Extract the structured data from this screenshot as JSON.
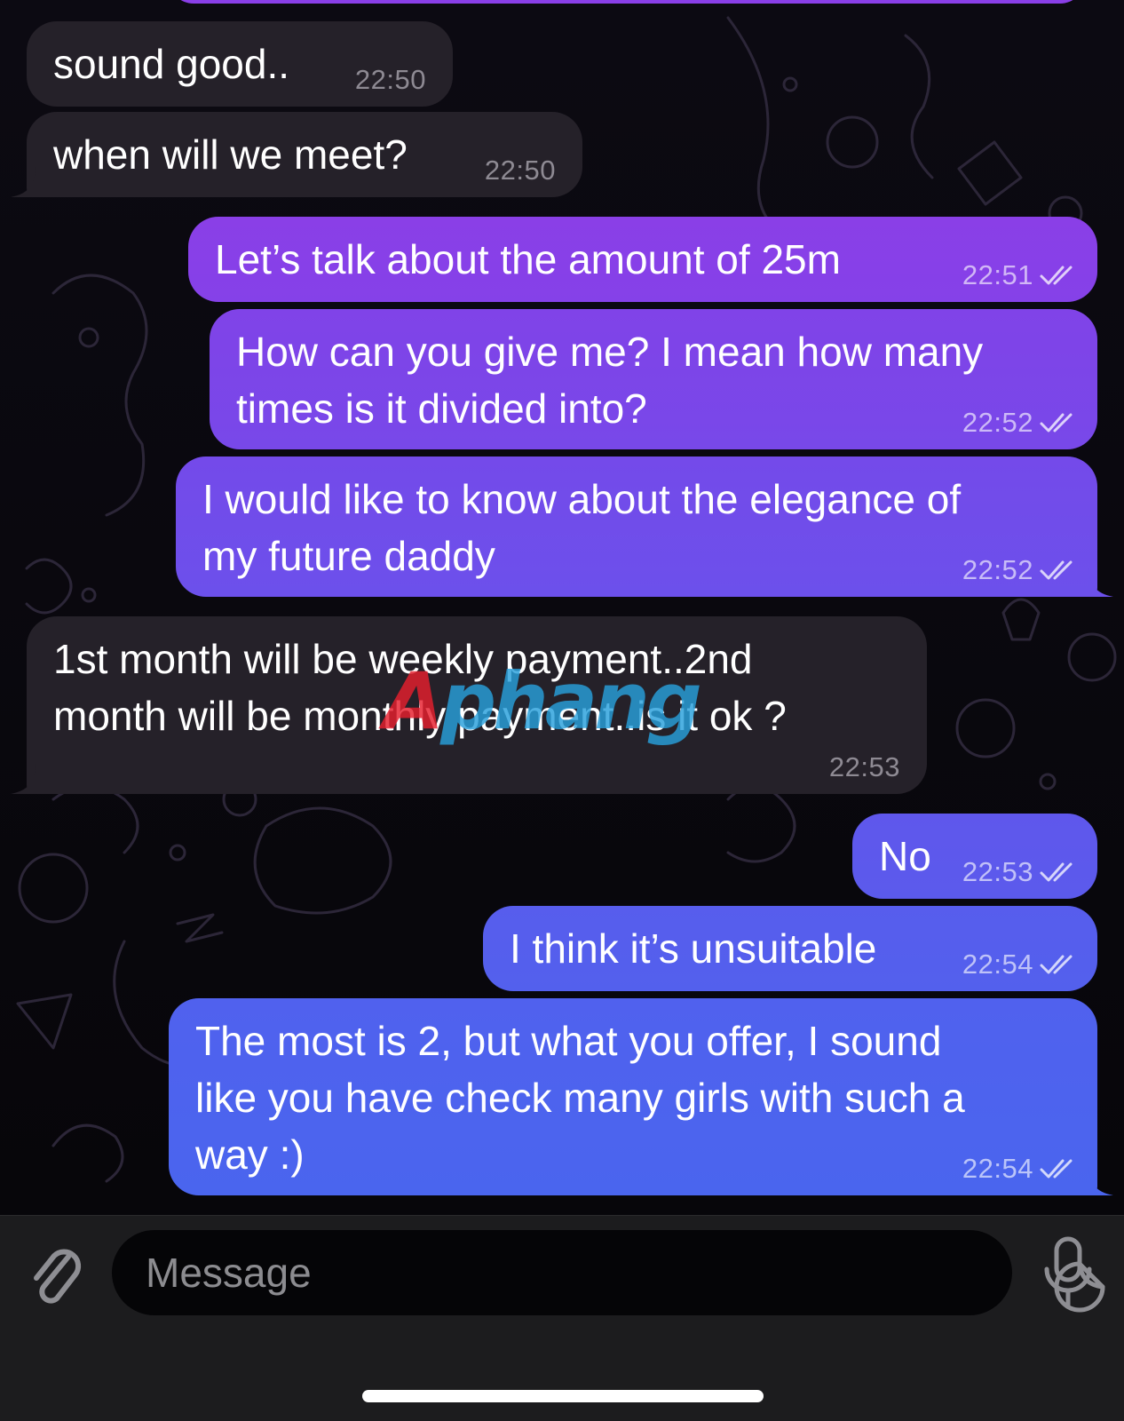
{
  "colors": {
    "incoming_bubble": "#252129",
    "outgoing_gradient_top": "#8a3fe7",
    "outgoing_gradient_bottom": "#4a65ee",
    "composer_bg": "#1c1c1e"
  },
  "messages": [
    {
      "direction": "incoming",
      "text": "sound good..",
      "time": "22:50",
      "read": false
    },
    {
      "direction": "incoming",
      "text": "when will we meet?",
      "time": "22:50",
      "read": false
    },
    {
      "direction": "outgoing",
      "text": "Let’s talk about the amount of 25m",
      "time": "22:51",
      "read": true
    },
    {
      "direction": "outgoing",
      "text": "How can you give me? I mean how many\ntimes is it divided into?",
      "time": "22:52",
      "read": true
    },
    {
      "direction": "outgoing",
      "text": "I would like to know about the elegance of\nmy future daddy",
      "time": "22:52",
      "read": true
    },
    {
      "direction": "incoming",
      "text": "1st month will be weekly payment..2nd\nmonth will be monthly payment..is it ok ?",
      "time": "22:53",
      "read": false
    },
    {
      "direction": "outgoing",
      "text": "No",
      "time": "22:53",
      "read": true
    },
    {
      "direction": "outgoing",
      "text": "I think it’s unsuitable",
      "time": "22:54",
      "read": true
    },
    {
      "direction": "outgoing",
      "text": "The most is 2, but what you offer, I sound\nlike you have check many girls with such a\nway :)",
      "time": "22:54",
      "read": true
    }
  ],
  "watermark": {
    "head": "A",
    "tail": "phang"
  },
  "composer": {
    "placeholder": "Message",
    "value": "",
    "icons": {
      "attach": "paperclip-icon",
      "sticker": "sticker-icon",
      "voice": "microphone-icon"
    }
  }
}
